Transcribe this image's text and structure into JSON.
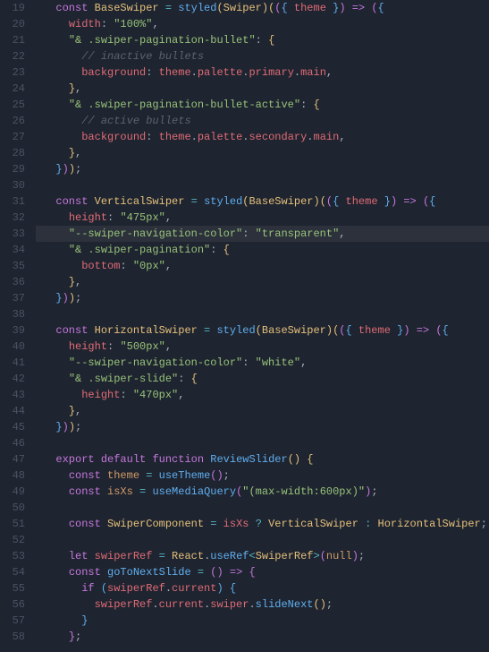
{
  "startLine": 19,
  "highlightedLine": 33,
  "lines": [
    {
      "n": 19,
      "seg": [
        [
          "",
          "  "
        ],
        [
          "kw",
          "const"
        ],
        [
          "",
          " "
        ],
        [
          "ty",
          "BaseSwiper"
        ],
        [
          "",
          " "
        ],
        [
          "op",
          "="
        ],
        [
          "",
          " "
        ],
        [
          "fn",
          "styled"
        ],
        [
          "brY",
          "("
        ],
        [
          "ty",
          "Swiper"
        ],
        [
          "brY",
          ")"
        ],
        [
          "brY",
          "("
        ],
        [
          "brP",
          "("
        ],
        [
          "brB",
          "{"
        ],
        [
          "",
          " "
        ],
        [
          "id",
          "theme"
        ],
        [
          "",
          " "
        ],
        [
          "brB",
          "}"
        ],
        [
          "brP",
          ")"
        ],
        [
          "",
          " "
        ],
        [
          "kw",
          "=>"
        ],
        [
          "",
          " "
        ],
        [
          "brP",
          "("
        ],
        [
          "brB",
          "{"
        ]
      ]
    },
    {
      "n": 20,
      "seg": [
        [
          "",
          "    "
        ],
        [
          "id",
          "width"
        ],
        [
          "pn",
          ":"
        ],
        [
          "",
          " "
        ],
        [
          "str",
          "\"100%\""
        ],
        [
          "pn",
          ","
        ]
      ]
    },
    {
      "n": 21,
      "seg": [
        [
          "",
          "    "
        ],
        [
          "str",
          "\"& .swiper-pagination-bullet\""
        ],
        [
          "pn",
          ":"
        ],
        [
          "",
          " "
        ],
        [
          "brY",
          "{"
        ]
      ]
    },
    {
      "n": 22,
      "seg": [
        [
          "",
          "      "
        ],
        [
          "com",
          "// inactive bullets"
        ]
      ]
    },
    {
      "n": 23,
      "seg": [
        [
          "",
          "      "
        ],
        [
          "id",
          "background"
        ],
        [
          "pn",
          ":"
        ],
        [
          "",
          " "
        ],
        [
          "id",
          "theme"
        ],
        [
          "pn",
          "."
        ],
        [
          "id",
          "palette"
        ],
        [
          "pn",
          "."
        ],
        [
          "id",
          "primary"
        ],
        [
          "pn",
          "."
        ],
        [
          "id",
          "main"
        ],
        [
          "pn",
          ","
        ]
      ]
    },
    {
      "n": 24,
      "seg": [
        [
          "",
          "    "
        ],
        [
          "brY",
          "}"
        ],
        [
          "pn",
          ","
        ]
      ]
    },
    {
      "n": 25,
      "seg": [
        [
          "",
          "    "
        ],
        [
          "str",
          "\"& .swiper-pagination-bullet-active\""
        ],
        [
          "pn",
          ":"
        ],
        [
          "",
          " "
        ],
        [
          "brY",
          "{"
        ]
      ]
    },
    {
      "n": 26,
      "seg": [
        [
          "",
          "      "
        ],
        [
          "com",
          "// active bullets"
        ]
      ]
    },
    {
      "n": 27,
      "seg": [
        [
          "",
          "      "
        ],
        [
          "id",
          "background"
        ],
        [
          "pn",
          ":"
        ],
        [
          "",
          " "
        ],
        [
          "id",
          "theme"
        ],
        [
          "pn",
          "."
        ],
        [
          "id",
          "palette"
        ],
        [
          "pn",
          "."
        ],
        [
          "id",
          "secondary"
        ],
        [
          "pn",
          "."
        ],
        [
          "id",
          "main"
        ],
        [
          "pn",
          ","
        ]
      ]
    },
    {
      "n": 28,
      "seg": [
        [
          "",
          "    "
        ],
        [
          "brY",
          "}"
        ],
        [
          "pn",
          ","
        ]
      ]
    },
    {
      "n": 29,
      "seg": [
        [
          "",
          "  "
        ],
        [
          "brB",
          "}"
        ],
        [
          "brP",
          ")"
        ],
        [
          "brY",
          ")"
        ],
        [
          "pn",
          ";"
        ]
      ]
    },
    {
      "n": 30,
      "seg": [
        [
          "",
          ""
        ]
      ]
    },
    {
      "n": 31,
      "seg": [
        [
          "",
          "  "
        ],
        [
          "kw",
          "const"
        ],
        [
          "",
          " "
        ],
        [
          "ty",
          "VerticalSwiper"
        ],
        [
          "",
          " "
        ],
        [
          "op",
          "="
        ],
        [
          "",
          " "
        ],
        [
          "fn",
          "styled"
        ],
        [
          "brY",
          "("
        ],
        [
          "ty",
          "BaseSwiper"
        ],
        [
          "brY",
          ")"
        ],
        [
          "brY",
          "("
        ],
        [
          "brP",
          "("
        ],
        [
          "brB",
          "{"
        ],
        [
          "",
          " "
        ],
        [
          "id",
          "theme"
        ],
        [
          "",
          " "
        ],
        [
          "brB",
          "}"
        ],
        [
          "brP",
          ")"
        ],
        [
          "",
          " "
        ],
        [
          "kw",
          "=>"
        ],
        [
          "",
          " "
        ],
        [
          "brP",
          "("
        ],
        [
          "brB",
          "{"
        ]
      ]
    },
    {
      "n": 32,
      "seg": [
        [
          "",
          "    "
        ],
        [
          "id",
          "height"
        ],
        [
          "pn",
          ":"
        ],
        [
          "",
          " "
        ],
        [
          "str",
          "\"475px\""
        ],
        [
          "pn",
          ","
        ]
      ]
    },
    {
      "n": 33,
      "seg": [
        [
          "",
          "    "
        ],
        [
          "str",
          "\"--swiper-navigation-color\""
        ],
        [
          "pn",
          ":"
        ],
        [
          "",
          " "
        ],
        [
          "str",
          "\"transparent\""
        ],
        [
          "pn",
          ","
        ]
      ]
    },
    {
      "n": 34,
      "seg": [
        [
          "",
          "    "
        ],
        [
          "str",
          "\"& .swiper-pagination\""
        ],
        [
          "pn",
          ":"
        ],
        [
          "",
          " "
        ],
        [
          "brY",
          "{"
        ]
      ]
    },
    {
      "n": 35,
      "seg": [
        [
          "",
          "      "
        ],
        [
          "id",
          "bottom"
        ],
        [
          "pn",
          ":"
        ],
        [
          "",
          " "
        ],
        [
          "str",
          "\"0px\""
        ],
        [
          "pn",
          ","
        ]
      ]
    },
    {
      "n": 36,
      "seg": [
        [
          "",
          "    "
        ],
        [
          "brY",
          "}"
        ],
        [
          "pn",
          ","
        ]
      ]
    },
    {
      "n": 37,
      "seg": [
        [
          "",
          "  "
        ],
        [
          "brB",
          "}"
        ],
        [
          "brP",
          ")"
        ],
        [
          "brY",
          ")"
        ],
        [
          "pn",
          ";"
        ]
      ]
    },
    {
      "n": 38,
      "seg": [
        [
          "",
          ""
        ]
      ]
    },
    {
      "n": 39,
      "seg": [
        [
          "",
          "  "
        ],
        [
          "kw",
          "const"
        ],
        [
          "",
          " "
        ],
        [
          "ty",
          "HorizontalSwiper"
        ],
        [
          "",
          " "
        ],
        [
          "op",
          "="
        ],
        [
          "",
          " "
        ],
        [
          "fn",
          "styled"
        ],
        [
          "brY",
          "("
        ],
        [
          "ty",
          "BaseSwiper"
        ],
        [
          "brY",
          ")"
        ],
        [
          "brY",
          "("
        ],
        [
          "brP",
          "("
        ],
        [
          "brB",
          "{"
        ],
        [
          "",
          " "
        ],
        [
          "id",
          "theme"
        ],
        [
          "",
          " "
        ],
        [
          "brB",
          "}"
        ],
        [
          "brP",
          ")"
        ],
        [
          "",
          " "
        ],
        [
          "kw",
          "=>"
        ],
        [
          "",
          " "
        ],
        [
          "brP",
          "("
        ],
        [
          "brB",
          "{"
        ]
      ]
    },
    {
      "n": 40,
      "seg": [
        [
          "",
          "    "
        ],
        [
          "id",
          "height"
        ],
        [
          "pn",
          ":"
        ],
        [
          "",
          " "
        ],
        [
          "str",
          "\"500px\""
        ],
        [
          "pn",
          ","
        ]
      ]
    },
    {
      "n": 41,
      "seg": [
        [
          "",
          "    "
        ],
        [
          "str",
          "\"--swiper-navigation-color\""
        ],
        [
          "pn",
          ":"
        ],
        [
          "",
          " "
        ],
        [
          "str",
          "\"white\""
        ],
        [
          "pn",
          ","
        ]
      ]
    },
    {
      "n": 42,
      "seg": [
        [
          "",
          "    "
        ],
        [
          "str",
          "\"& .swiper-slide\""
        ],
        [
          "pn",
          ":"
        ],
        [
          "",
          " "
        ],
        [
          "brY",
          "{"
        ]
      ]
    },
    {
      "n": 43,
      "seg": [
        [
          "",
          "      "
        ],
        [
          "id",
          "height"
        ],
        [
          "pn",
          ":"
        ],
        [
          "",
          " "
        ],
        [
          "str",
          "\"470px\""
        ],
        [
          "pn",
          ","
        ]
      ]
    },
    {
      "n": 44,
      "seg": [
        [
          "",
          "    "
        ],
        [
          "brY",
          "}"
        ],
        [
          "pn",
          ","
        ]
      ]
    },
    {
      "n": 45,
      "seg": [
        [
          "",
          "  "
        ],
        [
          "brB",
          "}"
        ],
        [
          "brP",
          ")"
        ],
        [
          "brY",
          ")"
        ],
        [
          "pn",
          ";"
        ]
      ]
    },
    {
      "n": 46,
      "seg": [
        [
          "",
          ""
        ]
      ]
    },
    {
      "n": 47,
      "seg": [
        [
          "",
          "  "
        ],
        [
          "kw",
          "export"
        ],
        [
          "",
          " "
        ],
        [
          "kw",
          "default"
        ],
        [
          "",
          " "
        ],
        [
          "kw",
          "function"
        ],
        [
          "",
          " "
        ],
        [
          "fn",
          "ReviewSlider"
        ],
        [
          "brY",
          "("
        ],
        [
          "brY",
          ")"
        ],
        [
          "",
          " "
        ],
        [
          "brY",
          "{"
        ]
      ]
    },
    {
      "n": 48,
      "seg": [
        [
          "",
          "    "
        ],
        [
          "kw",
          "const"
        ],
        [
          "",
          " "
        ],
        [
          "prop",
          "theme"
        ],
        [
          "",
          " "
        ],
        [
          "op",
          "="
        ],
        [
          "",
          " "
        ],
        [
          "fn",
          "useTheme"
        ],
        [
          "brP",
          "("
        ],
        [
          "brP",
          ")"
        ],
        [
          "pn",
          ";"
        ]
      ]
    },
    {
      "n": 49,
      "seg": [
        [
          "",
          "    "
        ],
        [
          "kw",
          "const"
        ],
        [
          "",
          " "
        ],
        [
          "prop",
          "isXs"
        ],
        [
          "",
          " "
        ],
        [
          "op",
          "="
        ],
        [
          "",
          " "
        ],
        [
          "fn",
          "useMediaQuery"
        ],
        [
          "brP",
          "("
        ],
        [
          "str",
          "\"(max-width:600px)\""
        ],
        [
          "brP",
          ")"
        ],
        [
          "pn",
          ";"
        ]
      ]
    },
    {
      "n": 50,
      "seg": [
        [
          "",
          ""
        ]
      ]
    },
    {
      "n": 51,
      "seg": [
        [
          "",
          "    "
        ],
        [
          "kw",
          "const"
        ],
        [
          "",
          " "
        ],
        [
          "ty",
          "SwiperComponent"
        ],
        [
          "",
          " "
        ],
        [
          "op",
          "="
        ],
        [
          "",
          " "
        ],
        [
          "id",
          "isXs"
        ],
        [
          "",
          " "
        ],
        [
          "op",
          "?"
        ],
        [
          "",
          " "
        ],
        [
          "ty",
          "VerticalSwiper"
        ],
        [
          "",
          " "
        ],
        [
          "op",
          ":"
        ],
        [
          "",
          " "
        ],
        [
          "ty",
          "HorizontalSwiper"
        ],
        [
          "pn",
          ";"
        ]
      ]
    },
    {
      "n": 52,
      "seg": [
        [
          "",
          ""
        ]
      ]
    },
    {
      "n": 53,
      "seg": [
        [
          "",
          "    "
        ],
        [
          "kw",
          "let"
        ],
        [
          "",
          " "
        ],
        [
          "id",
          "swiperRef"
        ],
        [
          "",
          " "
        ],
        [
          "op",
          "="
        ],
        [
          "",
          " "
        ],
        [
          "ty",
          "React"
        ],
        [
          "pn",
          "."
        ],
        [
          "fn",
          "useRef"
        ],
        [
          "op",
          "<"
        ],
        [
          "ty",
          "SwiperRef"
        ],
        [
          "op",
          ">"
        ],
        [
          "brP",
          "("
        ],
        [
          "nl",
          "null"
        ],
        [
          "brP",
          ")"
        ],
        [
          "pn",
          ";"
        ]
      ]
    },
    {
      "n": 54,
      "seg": [
        [
          "",
          "    "
        ],
        [
          "kw",
          "const"
        ],
        [
          "",
          " "
        ],
        [
          "fn",
          "goToNextSlide"
        ],
        [
          "",
          " "
        ],
        [
          "op",
          "="
        ],
        [
          "",
          " "
        ],
        [
          "brP",
          "("
        ],
        [
          "brP",
          ")"
        ],
        [
          "",
          " "
        ],
        [
          "kw",
          "=>"
        ],
        [
          "",
          " "
        ],
        [
          "brP",
          "{"
        ]
      ]
    },
    {
      "n": 55,
      "seg": [
        [
          "",
          "      "
        ],
        [
          "kw",
          "if"
        ],
        [
          "",
          " "
        ],
        [
          "brB",
          "("
        ],
        [
          "id",
          "swiperRef"
        ],
        [
          "pn",
          "."
        ],
        [
          "id",
          "current"
        ],
        [
          "brB",
          ")"
        ],
        [
          "",
          " "
        ],
        [
          "brB",
          "{"
        ]
      ]
    },
    {
      "n": 56,
      "seg": [
        [
          "",
          "        "
        ],
        [
          "id",
          "swiperRef"
        ],
        [
          "pn",
          "."
        ],
        [
          "id",
          "current"
        ],
        [
          "pn",
          "."
        ],
        [
          "id",
          "swiper"
        ],
        [
          "pn",
          "."
        ],
        [
          "fn",
          "slideNext"
        ],
        [
          "brY",
          "("
        ],
        [
          "brY",
          ")"
        ],
        [
          "pn",
          ";"
        ]
      ]
    },
    {
      "n": 57,
      "seg": [
        [
          "",
          "      "
        ],
        [
          "brB",
          "}"
        ]
      ]
    },
    {
      "n": 58,
      "seg": [
        [
          "",
          "    "
        ],
        [
          "brP",
          "}"
        ],
        [
          "pn",
          ";"
        ]
      ]
    }
  ]
}
